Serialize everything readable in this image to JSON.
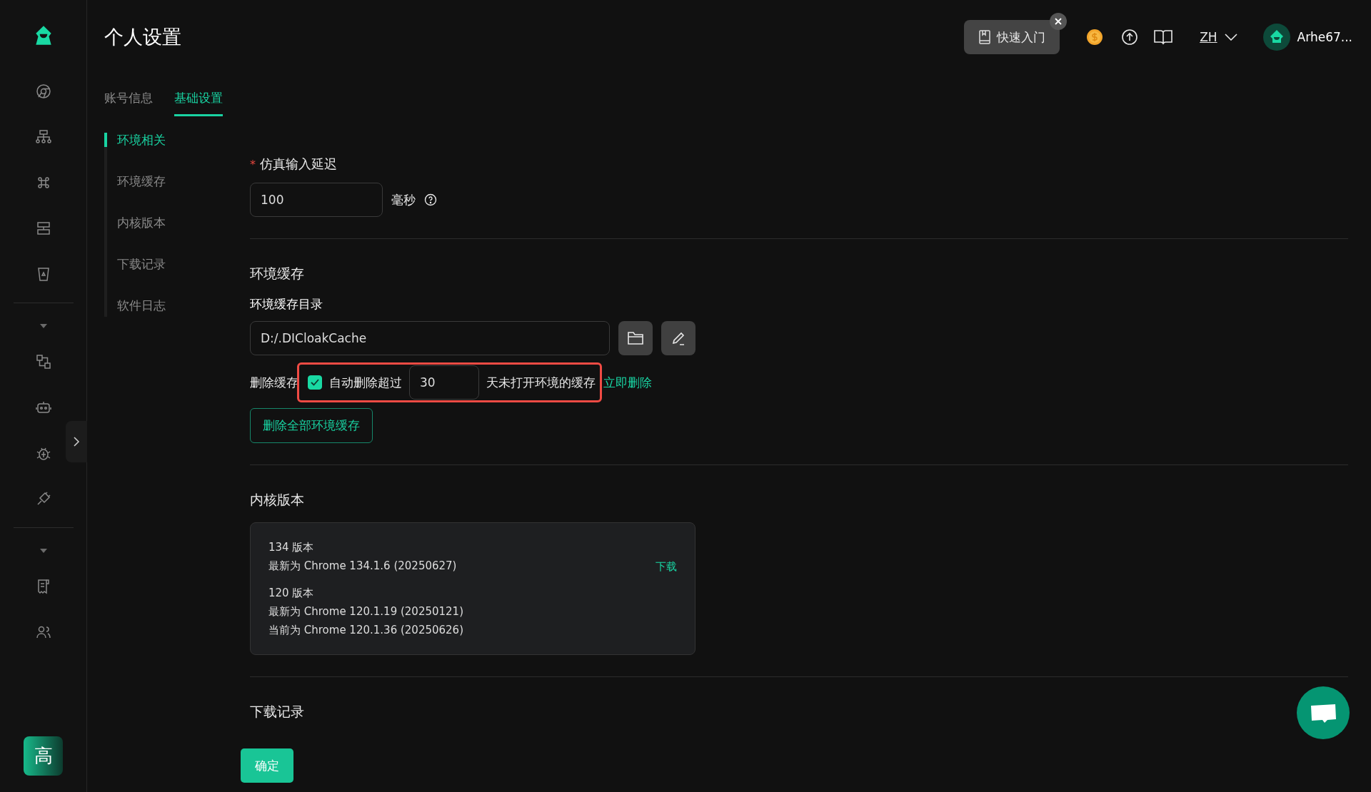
{
  "header": {
    "title": "个人设置",
    "quick_start": "快速入门",
    "language": "ZH",
    "user": "Arhe67..."
  },
  "tabs": [
    {
      "label": "账号信息",
      "selected": false
    },
    {
      "label": "基础设置",
      "selected": true
    }
  ],
  "side_nav": [
    {
      "label": "环境相关",
      "selected": true
    },
    {
      "label": "环境缓存",
      "selected": false
    },
    {
      "label": "内核版本",
      "selected": false
    },
    {
      "label": "下载记录",
      "selected": false
    },
    {
      "label": "软件日志",
      "selected": false
    }
  ],
  "input_delay": {
    "label": "仿真输入延迟",
    "required_mark": "*",
    "value": "100",
    "unit": "毫秒"
  },
  "cache": {
    "title": "环境缓存",
    "dir_label": "环境缓存目录",
    "dir_value": "D:/.DICloakCache",
    "delete_label": "删除缓存",
    "auto_delete": {
      "checked": true,
      "before": "自动删除超过",
      "days": "30",
      "after": "天未打开环境的缓存"
    },
    "delete_now": "立即删除",
    "delete_all": "删除全部环境缓存"
  },
  "kernel": {
    "title": "内核版本",
    "versions": [
      {
        "name": "134 版本",
        "lines": [
          "最新为 Chrome 134.1.6 (20250627)"
        ],
        "action": "下载"
      },
      {
        "name": "120 版本",
        "lines": [
          "最新为 Chrome 120.1.19 (20250121)",
          "当前为 Chrome 120.1.36 (20250626)"
        ]
      }
    ]
  },
  "downloads": {
    "title": "下载记录"
  },
  "confirm": "确定",
  "avatar_badge": "高"
}
